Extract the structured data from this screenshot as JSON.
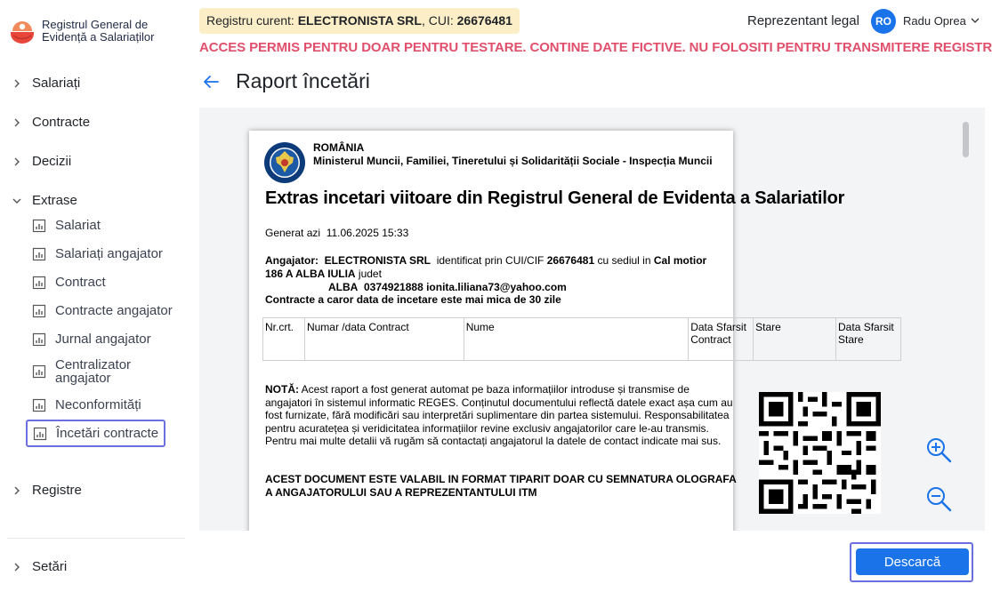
{
  "app": {
    "logo_line1": "Registrul General de",
    "logo_line2": "Evidență a Salariaților"
  },
  "sidebar": {
    "groups": [
      {
        "label": "Salariați"
      },
      {
        "label": "Contracte"
      },
      {
        "label": "Decizii"
      },
      {
        "label": "Extrase"
      },
      {
        "label": "Registre"
      },
      {
        "label": "Setări"
      }
    ],
    "extrase_items": [
      {
        "label": "Salariat"
      },
      {
        "label": "Salariați angajator"
      },
      {
        "label": "Contract"
      },
      {
        "label": "Contracte angajator"
      },
      {
        "label": "Jurnal angajator"
      },
      {
        "label": "Centralizator angajator"
      },
      {
        "label": "Neconformități"
      },
      {
        "label": "Încetări contracte"
      }
    ]
  },
  "header": {
    "registry_prefix": "Registru curent: ",
    "registry_name": "ELECTRONISTA SRL",
    "registry_cui_prefix": ", CUI: ",
    "registry_cui": "26676481",
    "rep_label": "Reprezentant legal",
    "avatar_initials": "RO",
    "user_name": "Radu Oprea",
    "warning": "ACCES PERMIS PENTRU DOAR PENTRU TESTARE. CONTINE DATE FICTIVE. NU FOLOSITI PENTRU TRANSMITERE REGISTRU",
    "page_title": "Raport încetări"
  },
  "document": {
    "country": "ROMÂNIA",
    "ministry": "Ministerul Muncii, Familiei, Tineretului și Solidarității Sociale - Inspecția Muncii",
    "title": "Extras incetari viitoare din Registrul General de Evidenta a Salariatilor",
    "generated_label": "Generat azi",
    "generated_value": "11.06.2025 15:33",
    "employer_label": "Angajator:",
    "employer_name": "ELECTRONISTA SRL",
    "employer_id_text": "identificat prin CUI/CIF",
    "employer_cui": "26676481",
    "employer_seat_text": "cu sediul in",
    "employer_address": "Cal motior 186 A ALBA IULIA",
    "employer_county_label": "judet",
    "employer_county": "ALBA",
    "employer_phone": "0374921888",
    "employer_email": "ionita.liliana73@yahoo.com",
    "contracts_heading": "Contracte a caror data de incetare este mai mica de 30 zile",
    "table_headers": [
      "Nr.crt.",
      "Numar /data Contract",
      "Nume",
      "Data Sfarsit Contract",
      "Stare",
      "Data Sfarsit Stare"
    ],
    "note_label": "NOTĂ:",
    "note_text": "Acest raport a fost generat automat pe baza informațiilor introduse și transmise de angajatori în sistemul informatic REGES. Conținutul documentului reflectă datele exact așa cum au fost furnizate, fără modificări sau interpretări suplimentare din partea sistemului. Responsabilitatea pentru acuratețea și veridicitatea informațiilor revine exclusiv angajatorilor care le-au transmis. Pentru mai multe detalii vă rugăm să contactați angajatorul la datele de contact indicate mai sus.",
    "validity_text": "ACEST DOCUMENT ESTE VALABIL IN FORMAT TIPARIT DOAR CU SEMNATURA OLOGRAFA A ANGAJATORULUI SAU A REPREZENTANTULUI ITM"
  },
  "actions": {
    "download_label": "Descarcă"
  },
  "icons": {
    "chevron": "chevron-right-icon",
    "report": "report-icon",
    "zoom_in": "zoom-in-icon",
    "zoom_out": "zoom-out-icon",
    "back": "arrow-left-icon"
  },
  "colors": {
    "accent": "#1a73e8",
    "warning": "#e04f6b",
    "chip_bg": "#fcefc7",
    "focus_outline": "#6b6fe0"
  }
}
